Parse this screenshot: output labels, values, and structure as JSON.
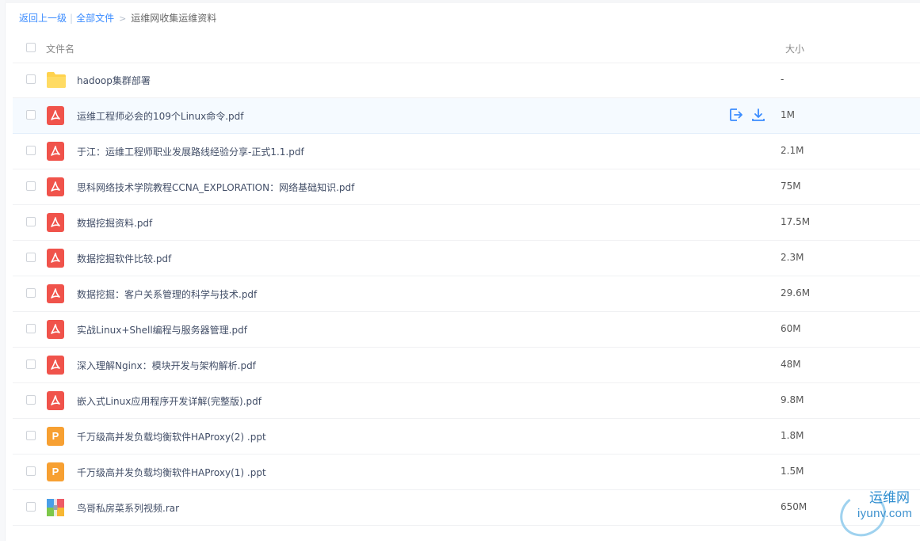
{
  "breadcrumb": {
    "back": "返回上一级",
    "all_files": "全部文件",
    "current": "运维网收集运维资料",
    "separator": "|",
    "arrow": ">"
  },
  "table": {
    "header_name": "文件名",
    "header_size": "大小",
    "rows": [
      {
        "type": "folder",
        "name": "hadoop集群部署",
        "size": "-"
      },
      {
        "type": "pdf",
        "name": "运维工程师必会的109个Linux命令.pdf",
        "size": "1M"
      },
      {
        "type": "pdf",
        "name": "于江：运维工程师职业发展路线经验分享-正式1.1.pdf",
        "size": "2.1M"
      },
      {
        "type": "pdf",
        "name": "思科网络技术学院教程CCNA_EXPLORATION：网络基础知识.pdf",
        "size": "75M"
      },
      {
        "type": "pdf",
        "name": "数据挖掘资料.pdf",
        "size": "17.5M"
      },
      {
        "type": "pdf",
        "name": "数据挖掘软件比较.pdf",
        "size": "2.3M"
      },
      {
        "type": "pdf",
        "name": "数据挖掘：客户关系管理的科学与技术.pdf",
        "size": "29.6M"
      },
      {
        "type": "pdf",
        "name": "实战Linux+Shell编程与服务器管理.pdf",
        "size": "60M"
      },
      {
        "type": "pdf",
        "name": "深入理解Nginx：模块开发与架构解析.pdf",
        "size": "48M"
      },
      {
        "type": "pdf",
        "name": "嵌入式Linux应用程序开发详解(完整版).pdf",
        "size": "9.8M"
      },
      {
        "type": "ppt",
        "name": "千万级高并发负载均衡软件HAProxy(2) .ppt",
        "size": "1.8M"
      },
      {
        "type": "ppt",
        "name": "千万级高并发负载均衡软件HAProxy(1) .ppt",
        "size": "1.5M"
      },
      {
        "type": "rar",
        "name": "鸟哥私房菜系列视频.rar",
        "size": "650M"
      }
    ]
  },
  "icons": {
    "folder": "folder-icon",
    "pdf": "pdf-file-icon",
    "ppt": "ppt-file-icon",
    "rar": "rar-archive-icon",
    "share": "share-icon",
    "download": "download-icon"
  },
  "ppt_letter": "P",
  "colors": {
    "accent": "#3b8cff",
    "pdf": "#f0534b",
    "ppt": "#f7a032",
    "folder": "#ffd24d"
  },
  "watermark": {
    "cn": "运维网",
    "en": "iyunv.com"
  }
}
